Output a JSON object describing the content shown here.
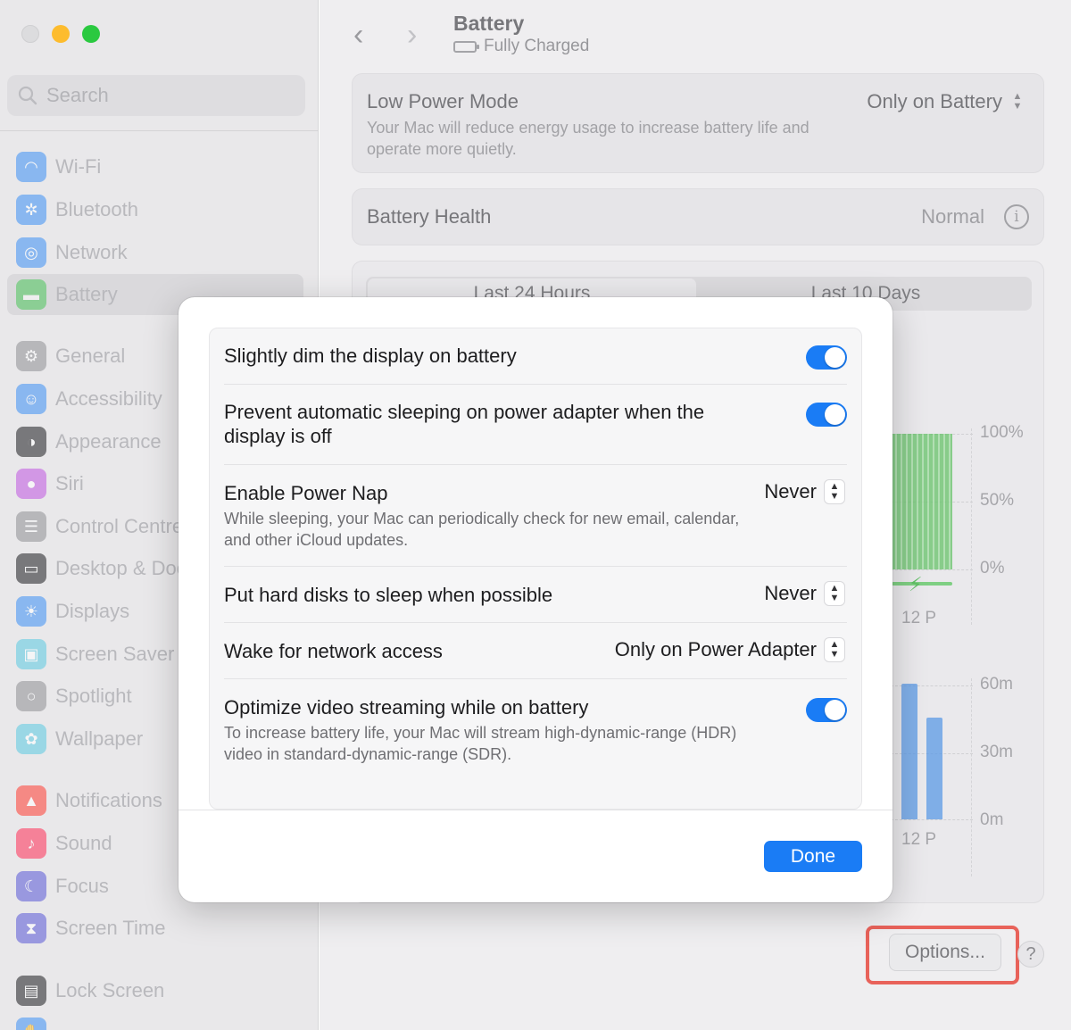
{
  "sidebar": {
    "search_placeholder": "Search",
    "items": [
      {
        "label": "Wi-Fi",
        "icon": "wifi-icon",
        "color": "#3b8ff5"
      },
      {
        "label": "Bluetooth",
        "icon": "bluetooth-icon",
        "color": "#3b8ff5"
      },
      {
        "label": "Network",
        "icon": "globe-icon",
        "color": "#3b8ff5"
      },
      {
        "label": "Battery",
        "icon": "battery-icon",
        "color": "#4cc55a"
      },
      {
        "label": "General",
        "icon": "gear-icon",
        "color": "#8e8e93"
      },
      {
        "label": "Accessibility",
        "icon": "accessibility-icon",
        "color": "#3b8ff5"
      },
      {
        "label": "Appearance",
        "icon": "appearance-icon",
        "color": "#1d1d1f"
      },
      {
        "label": "Siri",
        "icon": "siri-icon",
        "color": "#c055e0"
      },
      {
        "label": "Control Centre",
        "icon": "control-centre-icon",
        "color": "#8e8e93"
      },
      {
        "label": "Desktop & Dock",
        "icon": "dock-icon",
        "color": "#1d1d1f"
      },
      {
        "label": "Displays",
        "icon": "sun-icon",
        "color": "#3b8ff5"
      },
      {
        "label": "Screen Saver",
        "icon": "screen-saver-icon",
        "color": "#5ac8e0"
      },
      {
        "label": "Spotlight",
        "icon": "magnifier-icon",
        "color": "#8e8e93"
      },
      {
        "label": "Wallpaper",
        "icon": "wallpaper-icon",
        "color": "#5ac8e0"
      },
      {
        "label": "Notifications",
        "icon": "bell-icon",
        "color": "#ff3b30"
      },
      {
        "label": "Sound",
        "icon": "speaker-icon",
        "color": "#ff2d55"
      },
      {
        "label": "Focus",
        "icon": "moon-icon",
        "color": "#5856d6"
      },
      {
        "label": "Screen Time",
        "icon": "hourglass-icon",
        "color": "#5856d6"
      },
      {
        "label": "Lock Screen",
        "icon": "lock-icon",
        "color": "#1d1d1f"
      }
    ]
  },
  "header": {
    "title": "Battery",
    "subtitle": "Fully Charged"
  },
  "low_power": {
    "title": "Low Power Mode",
    "description": "Your Mac will reduce energy usage to increase battery life and operate more quietly.",
    "value": "Only on Battery"
  },
  "battery_health": {
    "title": "Battery Health",
    "value": "Normal"
  },
  "tabs": {
    "left": "Last 24 Hours",
    "right": "Last 10 Days"
  },
  "chart_level": {
    "y_ticks": [
      "100%",
      "50%",
      "0%"
    ],
    "x_tick": "12 P"
  },
  "chart_usage": {
    "y_ticks": [
      "60m",
      "30m",
      "0m"
    ],
    "x_tick": "12 P"
  },
  "footer": {
    "options_label": "Options...",
    "help_label": "?"
  },
  "sheet": {
    "rows": [
      {
        "title": "Slightly dim the display on battery",
        "control": "toggle",
        "on": true
      },
      {
        "title": "Prevent automatic sleeping on power adapter when the display is off",
        "control": "toggle",
        "on": true
      },
      {
        "title": "Enable Power Nap",
        "description": "While sleeping, your Mac can periodically check for new email, calendar, and other iCloud updates.",
        "control": "popup",
        "value": "Never"
      },
      {
        "title": "Put hard disks to sleep when possible",
        "control": "popup",
        "value": "Never"
      },
      {
        "title": "Wake for network access",
        "control": "popup",
        "value": "Only on Power Adapter"
      },
      {
        "title": "Optimize video streaming while on battery",
        "description": "To increase battery life, your Mac will stream high-dynamic-range (HDR) video in standard-dynamic-range (SDR).",
        "control": "toggle",
        "on": true
      }
    ],
    "done_label": "Done"
  },
  "colors": {
    "accent": "#1a7cf5",
    "highlight": "#e8625a"
  }
}
